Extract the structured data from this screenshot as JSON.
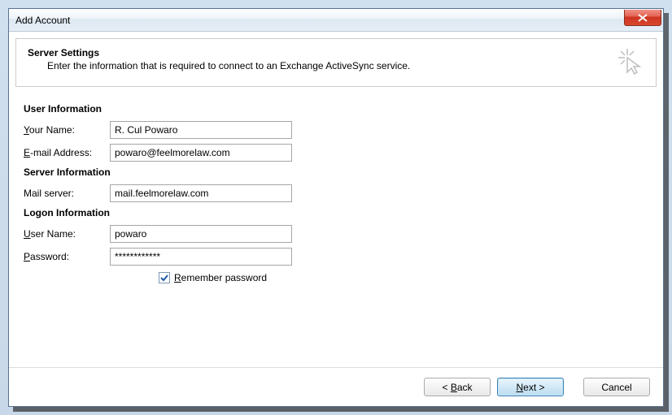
{
  "window": {
    "title": "Add Account"
  },
  "header": {
    "title": "Server Settings",
    "subtitle": "Enter the information that is required to connect to an Exchange ActiveSync service."
  },
  "sections": {
    "user_info_title": "User Information",
    "server_info_title": "Server Information",
    "logon_info_title": "Logon Information"
  },
  "labels": {
    "your_name": "Your Name:",
    "email": "E-mail Address:",
    "mail_server": "Mail server:",
    "user_name": "User Name:",
    "password": "Password:",
    "remember_password": "Remember password"
  },
  "values": {
    "your_name": "R. Cul Powaro",
    "email": "powaro@feelmorelaw.com",
    "mail_server": "mail.feelmorelaw.com",
    "user_name": "powaro",
    "password": "************",
    "remember_password": true
  },
  "buttons": {
    "back": "< Back",
    "next": "Next >",
    "cancel": "Cancel"
  }
}
